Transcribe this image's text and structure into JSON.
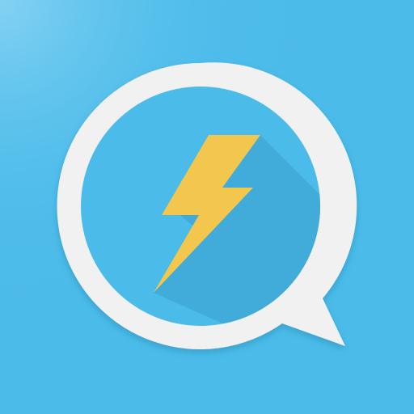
{
  "app_icon": {
    "icon_name": "chat-bubble-lightning-icon",
    "colors": {
      "background": "#4bbbe9",
      "background_highlight": "#7fd0f3",
      "bubble_outline": "#f1f1f1",
      "bubble_fill": "#4bbbe9",
      "bolt": "#f3c64d",
      "bolt_shadow": "#3ea6d4"
    }
  }
}
